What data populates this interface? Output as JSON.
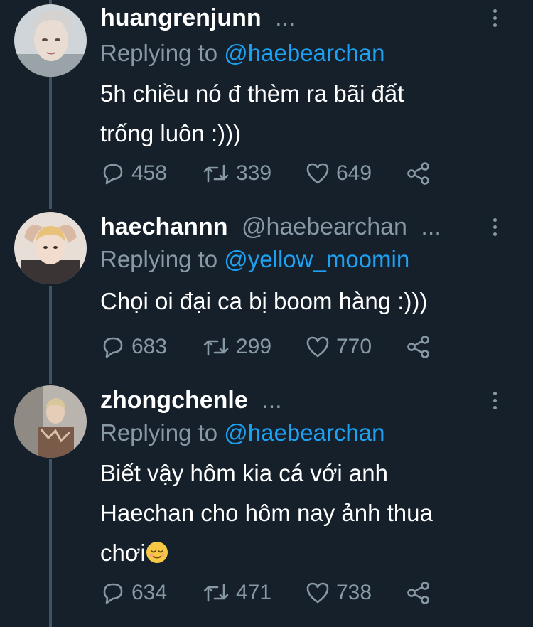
{
  "tweets": [
    {
      "name": "huangrenjunn",
      "handle": "",
      "more_dots": "...",
      "reply_prefix": "Replying to",
      "reply_to": "@haebearchan",
      "body_lines": [
        "5h chiều nó đ thèm ra bãi đất",
        "trống luôn :)))"
      ],
      "replies": "458",
      "retweets": "339",
      "likes": "649",
      "avatar_icon": "avatar-photo"
    },
    {
      "name": "haechannn",
      "handle": "@haebearchan",
      "more_dots": "...",
      "reply_prefix": "Replying to",
      "reply_to": "@yellow_moomin",
      "body_lines": [
        "Chọi oi đại ca bị boom hàng :)))"
      ],
      "replies": "683",
      "retweets": "299",
      "likes": "770",
      "avatar_icon": "avatar-photo"
    },
    {
      "name": "zhongchenle",
      "handle": "",
      "more_dots": "...",
      "reply_prefix": "Replying to",
      "reply_to": "@haebearchan",
      "body_lines": [
        "Biết vậy hôm kia cá với anh",
        "Haechan cho hôm nay ảnh thua",
        "chơi"
      ],
      "body_emoji": "relieved-face-emoji",
      "replies": "634",
      "retweets": "471",
      "likes": "738",
      "avatar_icon": "avatar-photo"
    }
  ],
  "colors": {
    "background": "#15202b",
    "text": "#ffffff",
    "muted": "#8899a6",
    "mention": "#1da1f2",
    "thread_line": "#3d5466"
  }
}
